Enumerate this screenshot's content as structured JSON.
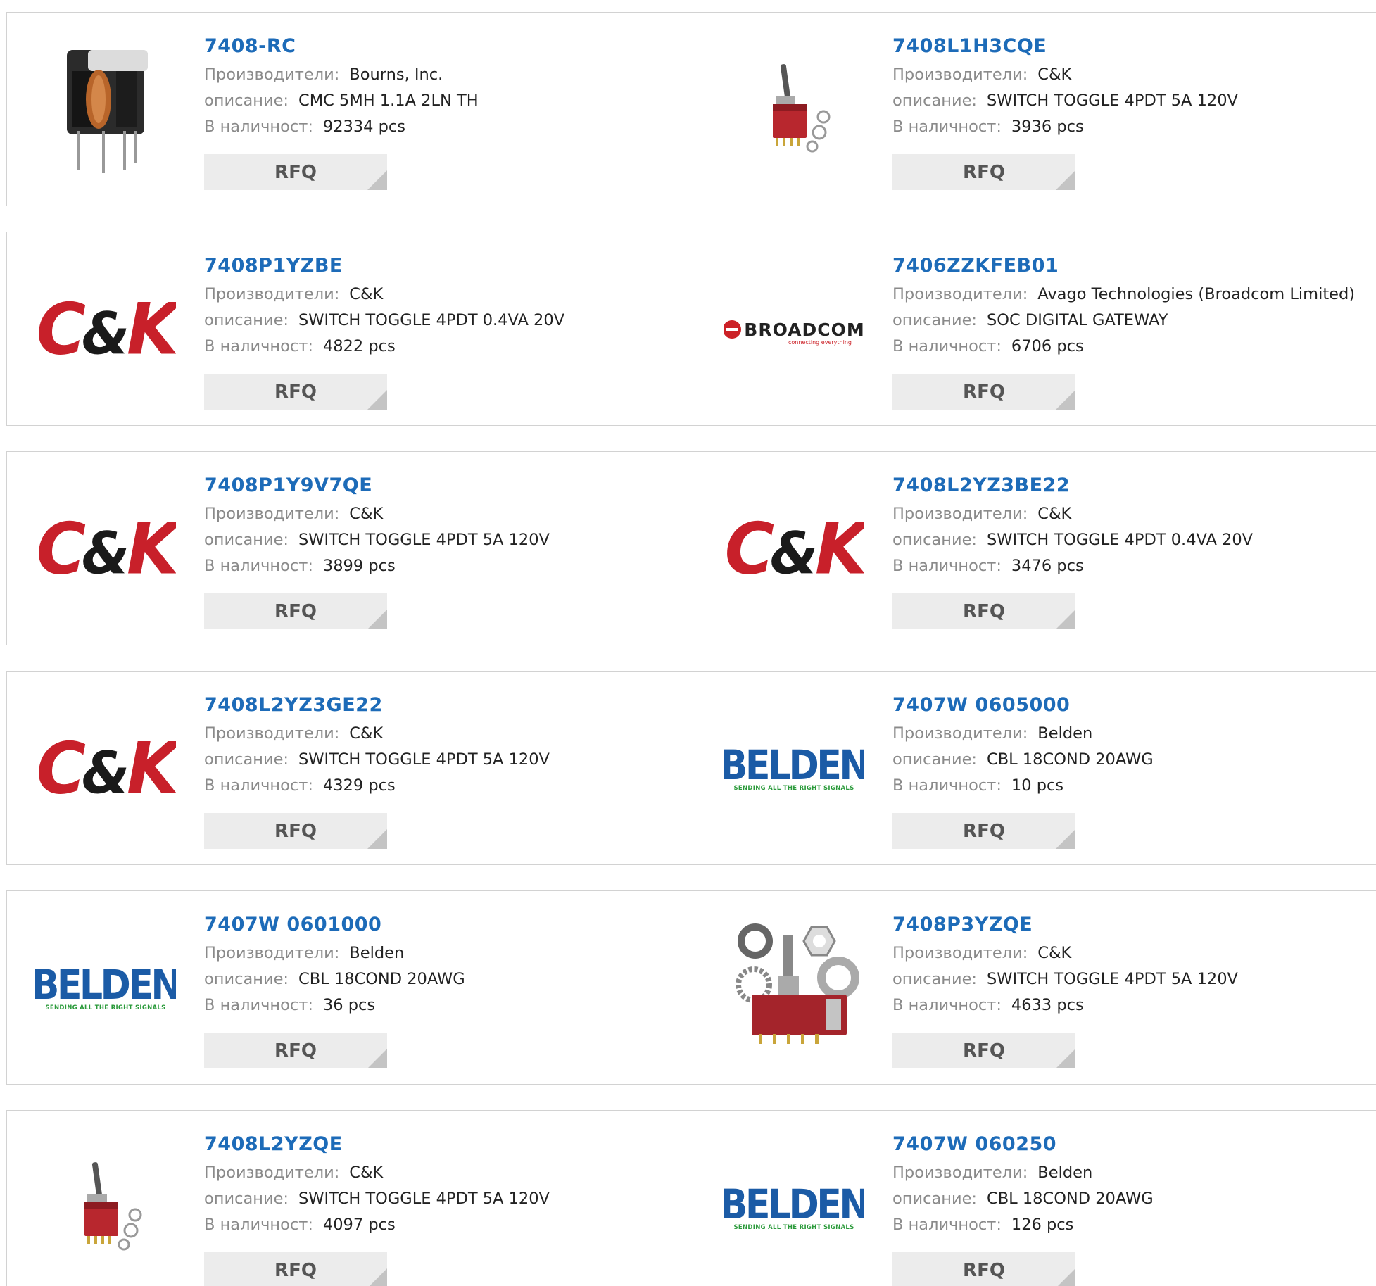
{
  "labels": {
    "manufacturer": "Производители:",
    "description": "описание:",
    "stock": "В наличност:",
    "rfq": "RFQ"
  },
  "products": [
    {
      "part": "7408-RC",
      "manufacturer": "Bourns, Inc.",
      "description": "CMC 5MH 1.1A 2LN TH",
      "stock": "92334 pcs",
      "image": "inductor-photo"
    },
    {
      "part": "7408L1H3CQE",
      "manufacturer": "C&K",
      "description": "SWITCH TOGGLE 4PDT 5A 120V",
      "stock": "3936 pcs",
      "image": "toggle-switch-photo"
    },
    {
      "part": "7408P1YZBE",
      "manufacturer": "C&K",
      "description": "SWITCH TOGGLE 4PDT 0.4VA 20V",
      "stock": "4822 pcs",
      "image": "ck-logo"
    },
    {
      "part": "7406ZZKFEB01",
      "manufacturer": "Avago Technologies (Broadcom Limited)",
      "description": "SOC DIGITAL GATEWAY",
      "stock": "6706 pcs",
      "image": "broadcom-logo"
    },
    {
      "part": "7408P1Y9V7QE",
      "manufacturer": "C&K",
      "description": "SWITCH TOGGLE 4PDT 5A 120V",
      "stock": "3899 pcs",
      "image": "ck-logo"
    },
    {
      "part": "7408L2YZ3BE22",
      "manufacturer": "C&K",
      "description": "SWITCH TOGGLE 4PDT 0.4VA 20V",
      "stock": "3476 pcs",
      "image": "ck-logo"
    },
    {
      "part": "7408L2YZ3GE22",
      "manufacturer": "C&K",
      "description": "SWITCH TOGGLE 4PDT 5A 120V",
      "stock": "4329 pcs",
      "image": "ck-logo"
    },
    {
      "part": "7407W 0605000",
      "manufacturer": "Belden",
      "description": "CBL 18COND 20AWG",
      "stock": "10 pcs",
      "image": "belden-logo"
    },
    {
      "part": "7407W 0601000",
      "manufacturer": "Belden",
      "description": "CBL 18COND 20AWG",
      "stock": "36 pcs",
      "image": "belden-logo"
    },
    {
      "part": "7408P3YZQE",
      "manufacturer": "C&K",
      "description": "SWITCH TOGGLE 4PDT 5A 120V",
      "stock": "4633 pcs",
      "image": "toggle-switch-large-photo"
    },
    {
      "part": "7408L2YZQE",
      "manufacturer": "C&K",
      "description": "SWITCH TOGGLE 4PDT 5A 120V",
      "stock": "4097 pcs",
      "image": "toggle-switch-photo"
    },
    {
      "part": "7407W 060250",
      "manufacturer": "Belden",
      "description": "CBL 18COND 20AWG",
      "stock": "126 pcs",
      "image": "belden-logo"
    }
  ],
  "logos": {
    "ck": {
      "c": "C",
      "amp": "&",
      "k": "K"
    },
    "broadcom": {
      "word": "BROADCOM",
      "tag": "connecting everything"
    },
    "belden": {
      "word": "BELDEN",
      "tag": "SENDING ALL THE RIGHT SIGNALS"
    }
  },
  "colors": {
    "part_link": "#1d6bb8",
    "ck_red": "#c8202a",
    "belden_blue": "#1b5ba6",
    "belden_green": "#2a9a3a"
  }
}
